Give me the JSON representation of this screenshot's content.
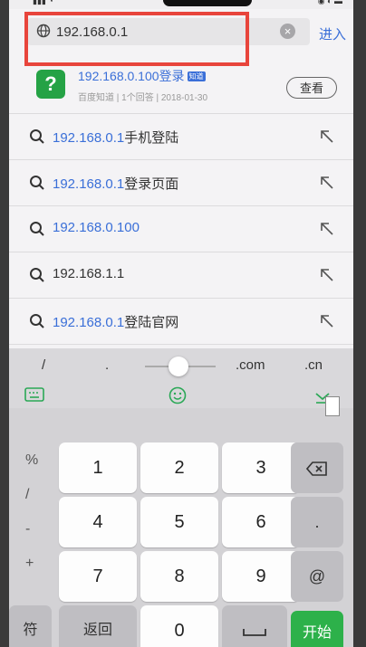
{
  "url_bar": {
    "value": "192.168.0.1",
    "enter_label": "进入"
  },
  "suggestion": {
    "title": "192.168.0.100登录",
    "badge": "知道",
    "meta": "百度知道 | 1个回答 | 2018-01-30",
    "button": "查看"
  },
  "history": [
    {
      "hl": "192.168.0.1",
      "rest": "手机登陆"
    },
    {
      "hl": "192.168.0.1",
      "rest": "登录页面"
    },
    {
      "hl": "192.168.0.100",
      "rest": ""
    },
    {
      "hl": "",
      "rest": "192.168.1.1"
    },
    {
      "hl": "192.168.0.1",
      "rest": "登陆官网"
    }
  ],
  "quick_keys": {
    "slash": "/",
    "dot": ".",
    "com": ".com",
    "cn": ".cn"
  },
  "keyboard": {
    "symbols": [
      "%",
      "/",
      "-",
      "+"
    ],
    "digits": [
      "1",
      "2",
      "3",
      "4",
      "5",
      "6",
      "7",
      "8",
      "9",
      "0"
    ],
    "at": "@",
    "fu": "符",
    "back": "返回",
    "start": "开始"
  },
  "colors": {
    "accent": "#3a6fd8",
    "highlight_box": "#e8453c",
    "start_key": "#2db14a"
  }
}
